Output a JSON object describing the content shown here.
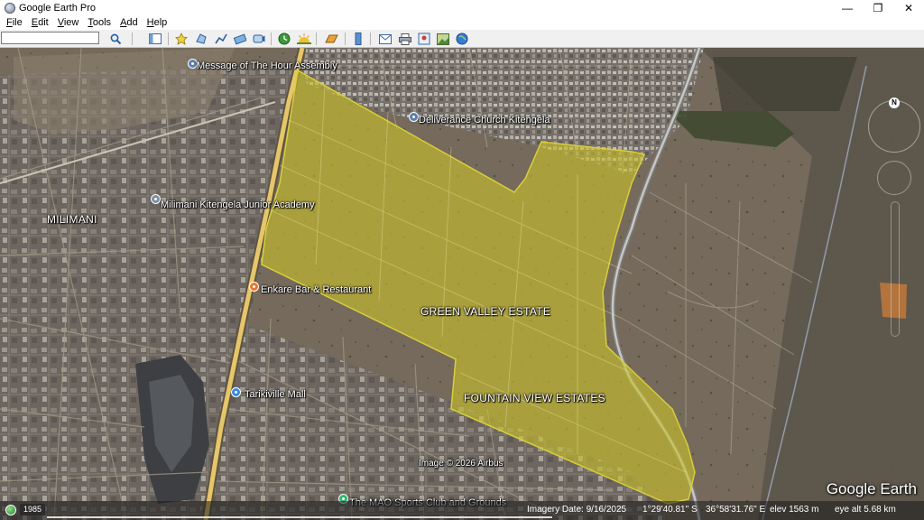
{
  "window": {
    "title": "Google Earth Pro",
    "minimize": "—",
    "restore": "❐",
    "close": "✕"
  },
  "menu": [
    "File",
    "Edit",
    "View",
    "Tools",
    "Add",
    "Help"
  ],
  "search": {
    "value": "",
    "placeholder": ""
  },
  "map": {
    "labels": {
      "message_assembly": "Message of The Hour Assembly",
      "deliverance": "Deliverance Church Kitengela",
      "milimani": "MILIMANI",
      "milimani_academy": "Milimani Kitengela Junior Academy",
      "enkare": "Enkare Bar & Restaurant",
      "green_valley": "GREEN VALLEY ESTATE",
      "tarikiville": "Tarikiville Mall",
      "fountain_view": "FOUNTAIN VIEW ESTATES",
      "image_credit": "Image © 2026 Airbus",
      "mao_sports": "The MAO Sports Club and Grounds"
    },
    "compass_north": "N",
    "logo": "Google Earth",
    "colors": {
      "polygon_fill": "#c9c02a",
      "polygon_stroke": "#d8cf3a",
      "road": "#e6c66a"
    }
  },
  "status": {
    "year": "1985",
    "imagery_date": "Imagery Date: 9/16/2025",
    "lat": "1°29'40.81\" S",
    "lon": "36°58'31.76\" E",
    "elev": "elev  1563 m",
    "eye_alt": "eye alt   5.68 km"
  }
}
